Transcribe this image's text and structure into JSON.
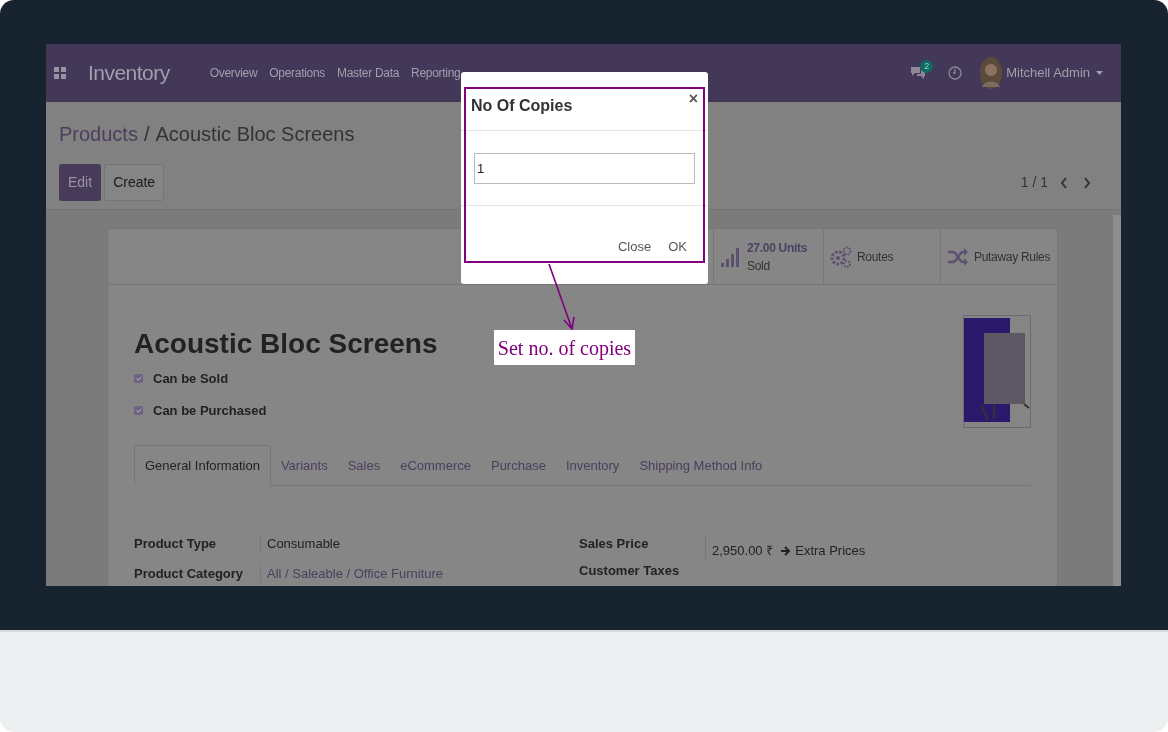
{
  "navbar": {
    "app_name": "Inventory",
    "menu": [
      "Overview",
      "Operations",
      "Master Data",
      "Reporting"
    ],
    "messages_count": "2",
    "user": "Mitchell Admin"
  },
  "breadcrumb": {
    "parent": "Products",
    "separator": "/",
    "current": "Acoustic Bloc Screens"
  },
  "actions": [
    "Edit",
    "Create"
  ],
  "pager": "1 / 1",
  "smart_buttons": [
    {
      "kind": "stat",
      "value": "27.00 Units",
      "label": "Sold"
    },
    {
      "kind": "routes",
      "label": "Routes"
    },
    {
      "kind": "putaway",
      "label": "Putaway Rules"
    }
  ],
  "product": {
    "name": "Acoustic Bloc Screens",
    "options": [
      {
        "label": "Can be Sold",
        "checked": true
      },
      {
        "label": "Can be Purchased",
        "checked": true
      }
    ],
    "tabs": [
      {
        "label": "General Information",
        "selected": true
      },
      {
        "label": "Variants",
        "selected": false
      },
      {
        "label": "Sales",
        "selected": false
      },
      {
        "label": "eCommerce",
        "selected": false
      },
      {
        "label": "Purchase",
        "selected": false
      },
      {
        "label": "Inventory",
        "selected": false
      },
      {
        "label": "Shipping Method Info",
        "selected": false
      }
    ],
    "left_fields": [
      {
        "label": "Product Type",
        "value": "Consumable",
        "kind": "text"
      },
      {
        "label": "Product Category",
        "value": "All / Saleable / Office Furniture",
        "kind": "link"
      }
    ],
    "right_fields": [
      {
        "label": "Sales Price",
        "value": "2,950.00 ₹",
        "extra": "Extra Prices"
      },
      {
        "label": "Customer Taxes"
      }
    ]
  },
  "dialog": {
    "title": "No Of Copies",
    "close": "×",
    "value": "1",
    "buttons": [
      "Close",
      "OK"
    ]
  },
  "annotation": {
    "text": "Set no. of copies"
  }
}
